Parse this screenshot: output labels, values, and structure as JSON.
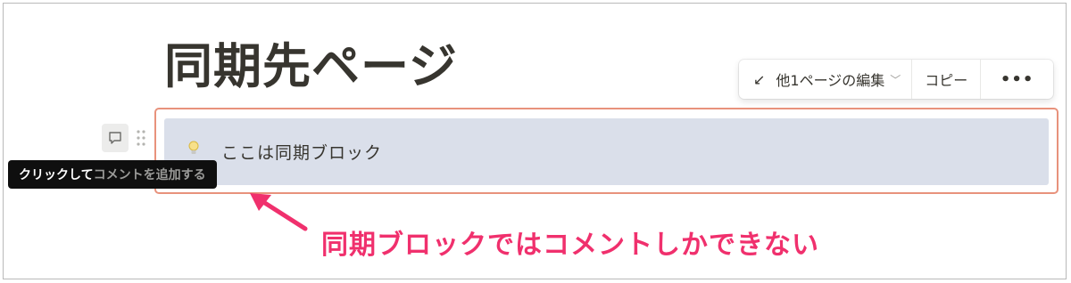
{
  "page": {
    "title": "同期先ページ"
  },
  "sync_toolbar": {
    "edit_label": "他1ページの編集",
    "copy_label": "コピー",
    "more_label": "•••",
    "arrow_icon": "arrow-down-left-icon",
    "chevron_icon": "chevron-down-icon"
  },
  "sync_block": {
    "text": "ここは同期ブロック",
    "icon": "lightbulb-icon",
    "border_color": "#e8927c",
    "background_color": "#dadfea"
  },
  "tooltip": {
    "strong": "クリックして",
    "muted": "コメントを追加する"
  },
  "annotation": {
    "text": "同期ブロックではコメントしかできない",
    "color": "#f0306d"
  }
}
